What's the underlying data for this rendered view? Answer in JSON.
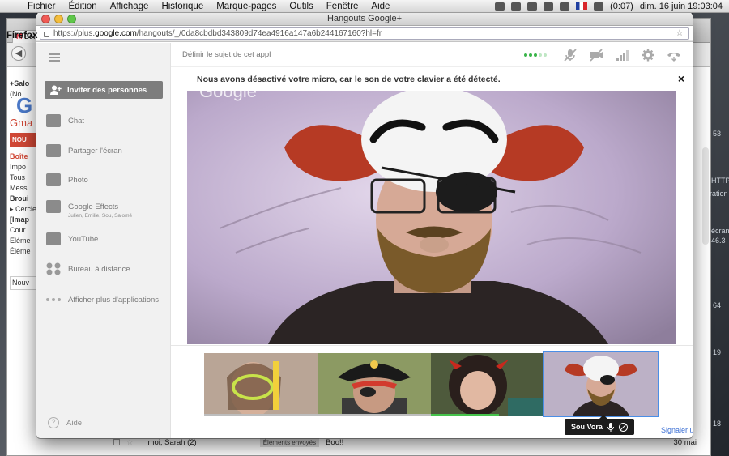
{
  "menubar": {
    "app": "Firefox",
    "items": [
      "Fichier",
      "Édition",
      "Affichage",
      "Historique",
      "Marque-pages",
      "Outils",
      "Fenêtre",
      "Aide"
    ],
    "battery": "(0:07)",
    "datetime": "dim. 16 juin  19:03:04"
  },
  "background": {
    "tab_label": "Boî",
    "gmail_logo": "G",
    "gmail_label": "Gma",
    "new_button": "NOU",
    "left_items": [
      "+Salo",
      "(No",
      "Boîte",
      "Impo",
      "Tous l",
      "Mess",
      "Broui",
      "▸ Cercle",
      "[Imap",
      "Cour",
      "Éléme",
      "Éléme",
      "Nouv"
    ],
    "bottom_row": {
      "sender": "moi, Sarah (2)",
      "label": "Éléments envoyés",
      "subject": "Boo!!",
      "date": "30 mai"
    },
    "desktop_text": [
      "HTTP",
      "ratien",
      "écran",
      "46.3",
      "19",
      "53",
      "64",
      "18"
    ]
  },
  "window": {
    "title": "Hangouts Google+",
    "url_prefix": "https://plus.",
    "url_domain": "google.com",
    "url_rest": "/hangouts/_/0da8cbdbd343809d74ea4916a147a6b244167160?hl=fr"
  },
  "sidebar": {
    "invite": "Inviter des personnes",
    "items": [
      {
        "label": "Chat",
        "icon": "chat-icon"
      },
      {
        "label": "Partager l'écran",
        "icon": "screenshare-icon"
      },
      {
        "label": "Photo",
        "icon": "camera-icon"
      },
      {
        "label": "Google Effects",
        "sub": "Julien, Emilie, Sou, Salomé",
        "icon": "effects-icon"
      },
      {
        "label": "YouTube",
        "icon": "youtube-icon"
      },
      {
        "label": "Bureau à distance",
        "icon": "remote-desktop-icon"
      },
      {
        "label": "Afficher plus d'applications",
        "icon": "more-dots-icon"
      }
    ],
    "help": "Aide"
  },
  "topbar": {
    "topic_placeholder": "Définir le sujet de cet appl"
  },
  "notice": {
    "text": "Nous avons désactivé votre micro, car le son de votre clavier a été détecté.",
    "close": "×"
  },
  "video": {
    "watermark": "Google"
  },
  "participants": [
    {
      "name": "Julien",
      "effect": "diving mask"
    },
    {
      "name": "Emilie",
      "effect": "pirate"
    },
    {
      "name": "Salomé",
      "effect": "devil horns"
    },
    {
      "name": "Sou Vora",
      "effect": "clown"
    }
  ],
  "tooltip": {
    "name": "Sou Vora"
  },
  "report_link": "Signaler un problème",
  "colors": {
    "accent": "#4a8ee6",
    "invite_bg": "#7d7d7d",
    "link": "#3b6fd4",
    "speaking": "#46c34c"
  }
}
